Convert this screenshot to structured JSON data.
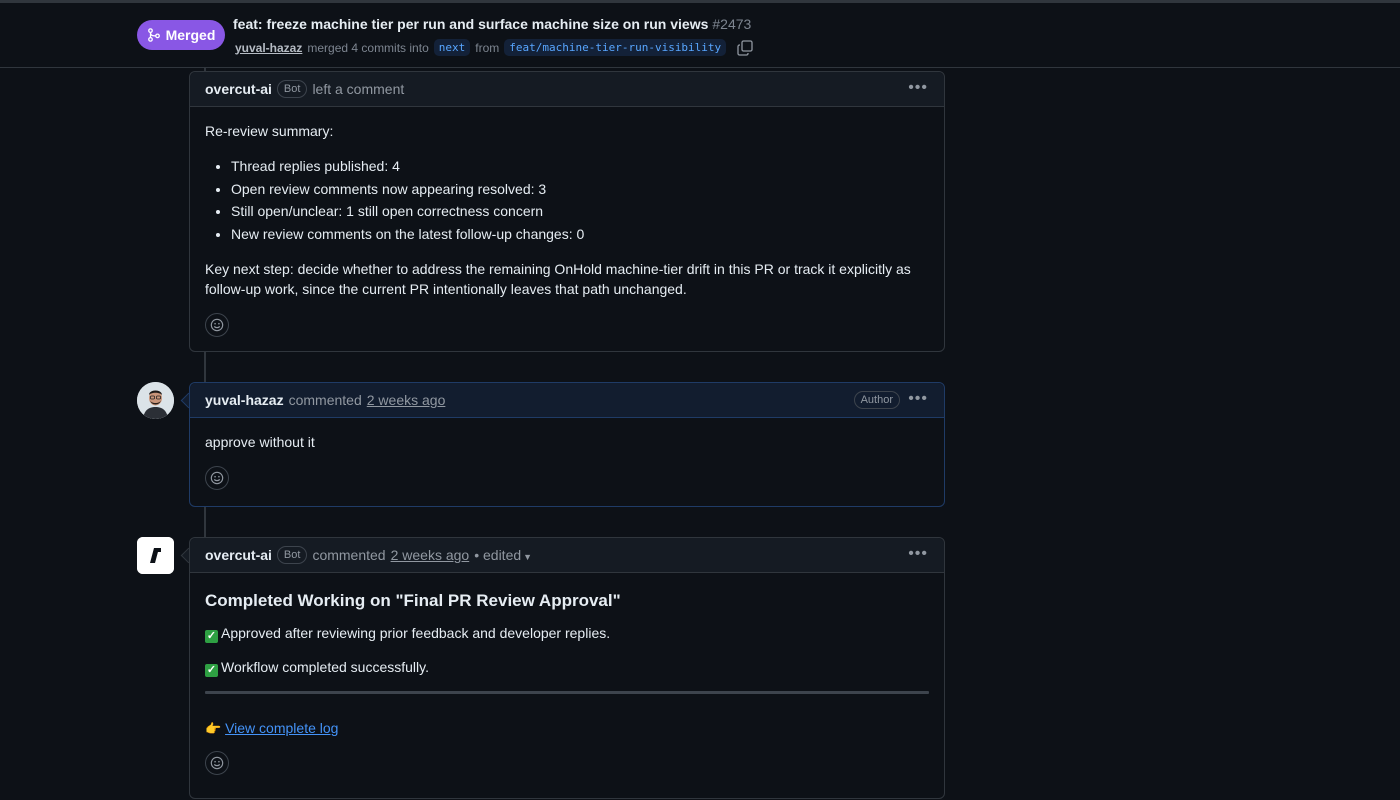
{
  "pr": {
    "status": "Merged",
    "title": "feat: freeze machine tier per run and surface machine size on run views",
    "number": "#2473",
    "merged_by": "yuval-hazaz",
    "merged_text": "merged 4 commits into",
    "base_branch": "next",
    "from_text": "from",
    "head_branch": "feat/machine-tier-run-visibility"
  },
  "comments": [
    {
      "author": "overcut-ai",
      "badge": "Bot",
      "action": "left a comment",
      "intro": "Re-review summary:",
      "bullets": [
        "Thread replies published: 4",
        "Open review comments now appearing resolved: 3",
        "Still open/unclear: 1 still open correctness concern",
        "New review comments on the latest follow-up changes: 0"
      ],
      "footer": "Key next step: decide whether to address the remaining OnHold machine-tier drift in this PR or track it explicitly as follow-up work, since the current PR intentionally leaves that path unchanged."
    },
    {
      "author": "yuval-hazaz",
      "action": "commented",
      "time": "2 weeks ago",
      "role_badge": "Author",
      "body": "approve without it"
    },
    {
      "author": "overcut-ai",
      "badge": "Bot",
      "action": "commented",
      "time": "2 weeks ago",
      "edited": "• edited",
      "heading": "Completed Working on \"Final PR Review Approval\"",
      "line1": "Approved after reviewing prior feedback and developer replies.",
      "line2": "Workflow completed successfully.",
      "link_text": "View complete log"
    }
  ],
  "icons": {
    "merge": "git-merge-icon",
    "copy": "copy-icon",
    "more": "kebab-horizontal-icon",
    "reaction": "smiley-icon",
    "check": "check-box-icon",
    "pointer": "pointing-hand-icon"
  },
  "colors": {
    "merged": "#8957e5",
    "link": "#4493f8",
    "background": "#0d1117"
  }
}
